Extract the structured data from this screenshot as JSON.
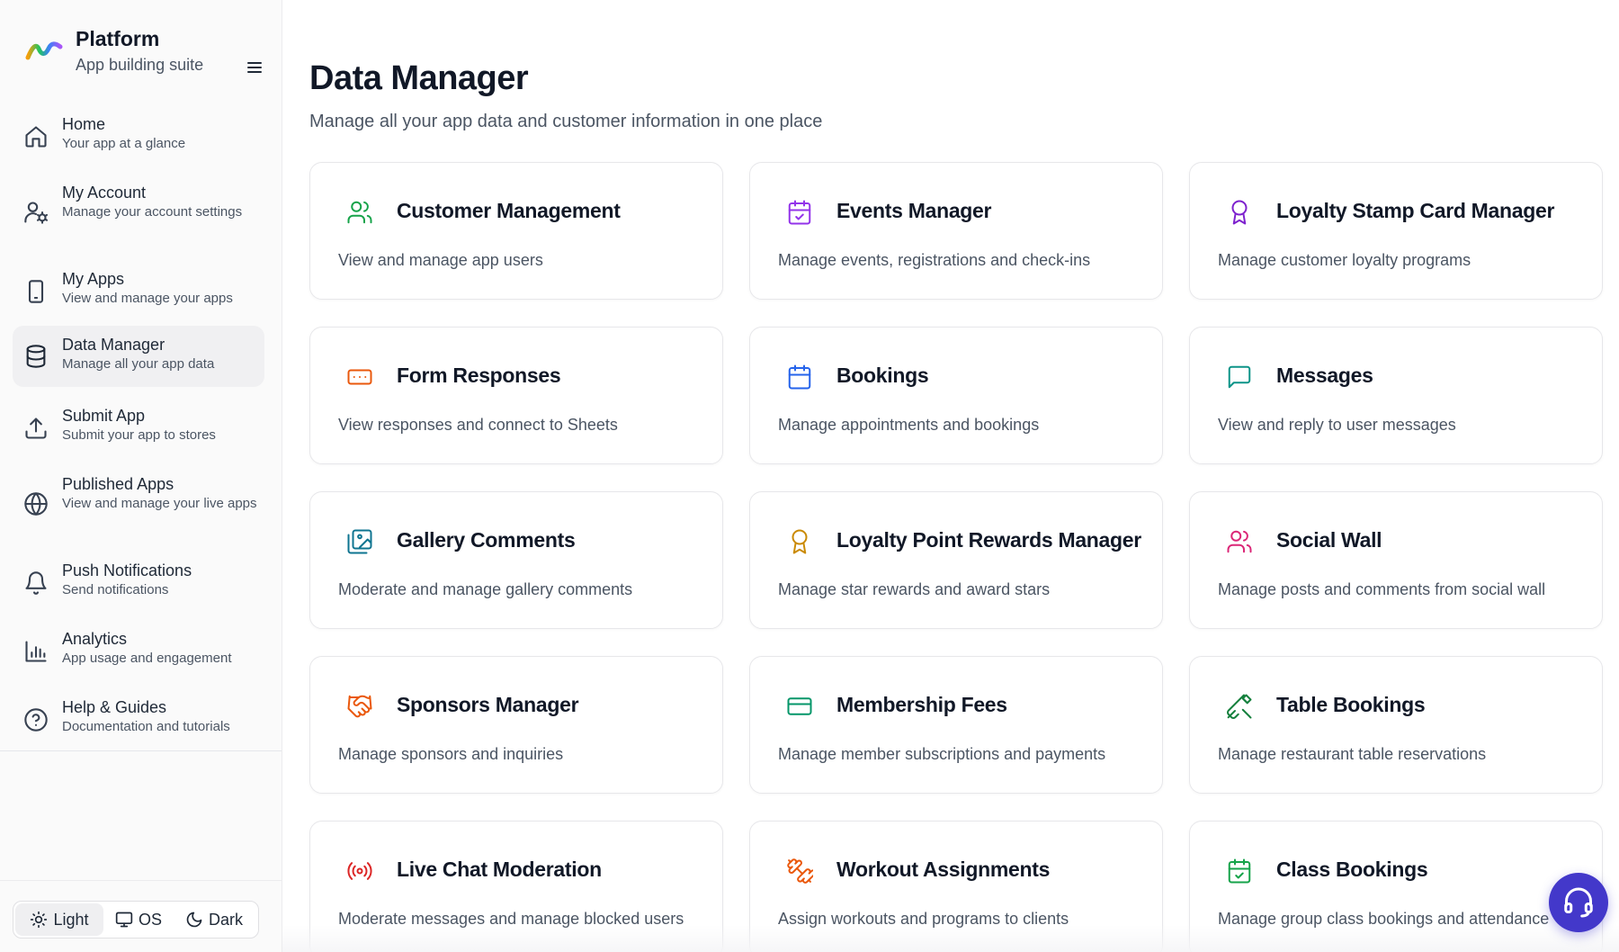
{
  "brand": {
    "name": "Platform",
    "tagline": "App building suite"
  },
  "sidebar": {
    "items": [
      {
        "label": "Home",
        "desc": "Your app at a glance",
        "icon": "home-icon"
      },
      {
        "label": "My Account",
        "desc": "Manage your account settings",
        "icon": "user-settings-icon"
      },
      {
        "label": "My Apps",
        "desc": "View and manage your apps",
        "icon": "smartphone-icon"
      },
      {
        "label": "Data Manager",
        "desc": "Manage all your app data",
        "icon": "database-icon",
        "active": true
      },
      {
        "label": "Submit App",
        "desc": "Submit your app to stores",
        "icon": "upload-icon"
      },
      {
        "label": "Published Apps",
        "desc": "View and manage your live apps",
        "icon": "globe-icon"
      },
      {
        "label": "Push Notifications",
        "desc": "Send notifications",
        "icon": "bell-icon"
      },
      {
        "label": "Analytics",
        "desc": "App usage and engagement",
        "icon": "bar-chart-icon"
      },
      {
        "label": "Help & Guides",
        "desc": "Documentation and tutorials",
        "icon": "help-circle-icon"
      }
    ]
  },
  "theme": {
    "light": "Light",
    "os": "OS",
    "dark": "Dark",
    "selected": "Light"
  },
  "page": {
    "title": "Data Manager",
    "subtitle": "Manage all your app data and customer information in one place"
  },
  "cards": [
    {
      "title": "Customer Management",
      "desc": "View and manage app users",
      "icon": "users-icon",
      "color": "#16a34a"
    },
    {
      "title": "Events Manager",
      "desc": "Manage events, registrations and check-ins",
      "icon": "calendar-check-icon",
      "color": "#9333ea"
    },
    {
      "title": "Loyalty Stamp Card Manager",
      "desc": "Manage customer loyalty programs",
      "icon": "award-icon",
      "color": "#7e22ce"
    },
    {
      "title": "Form Responses",
      "desc": "View responses and connect to Sheets",
      "icon": "form-input-icon",
      "color": "#ea580c"
    },
    {
      "title": "Bookings",
      "desc": "Manage appointments and bookings",
      "icon": "calendar-icon",
      "color": "#2563eb"
    },
    {
      "title": "Messages",
      "desc": "View and reply to user messages",
      "icon": "message-square-icon",
      "color": "#0d9488"
    },
    {
      "title": "Gallery Comments",
      "desc": "Moderate and manage gallery comments",
      "icon": "images-icon",
      "color": "#0e7490"
    },
    {
      "title": "Loyalty Point Rewards Manager",
      "desc": "Manage star rewards and award stars",
      "icon": "award-icon",
      "color": "#ca8a04"
    },
    {
      "title": "Social Wall",
      "desc": "Manage posts and comments from social wall",
      "icon": "users-icon",
      "color": "#db2777"
    },
    {
      "title": "Sponsors Manager",
      "desc": "Manage sponsors and inquiries",
      "icon": "handshake-icon",
      "color": "#ea580c"
    },
    {
      "title": "Membership Fees",
      "desc": "Manage member subscriptions and payments",
      "icon": "credit-card-icon",
      "color": "#059669"
    },
    {
      "title": "Table Bookings",
      "desc": "Manage restaurant table reservations",
      "icon": "utensils-crossed-icon",
      "color": "#15803d"
    },
    {
      "title": "Live Chat Moderation",
      "desc": "Moderate messages and manage blocked users",
      "icon": "radio-icon",
      "color": "#dc2626"
    },
    {
      "title": "Workout Assignments",
      "desc": "Assign workouts and programs to clients",
      "icon": "dumbbell-icon",
      "color": "#ea580c"
    },
    {
      "title": "Class Bookings",
      "desc": "Manage group class bookings and attendance",
      "icon": "calendar-check-icon",
      "color": "#16a34a"
    }
  ],
  "support": {
    "icon": "headset-icon",
    "color": "#4338ca"
  }
}
